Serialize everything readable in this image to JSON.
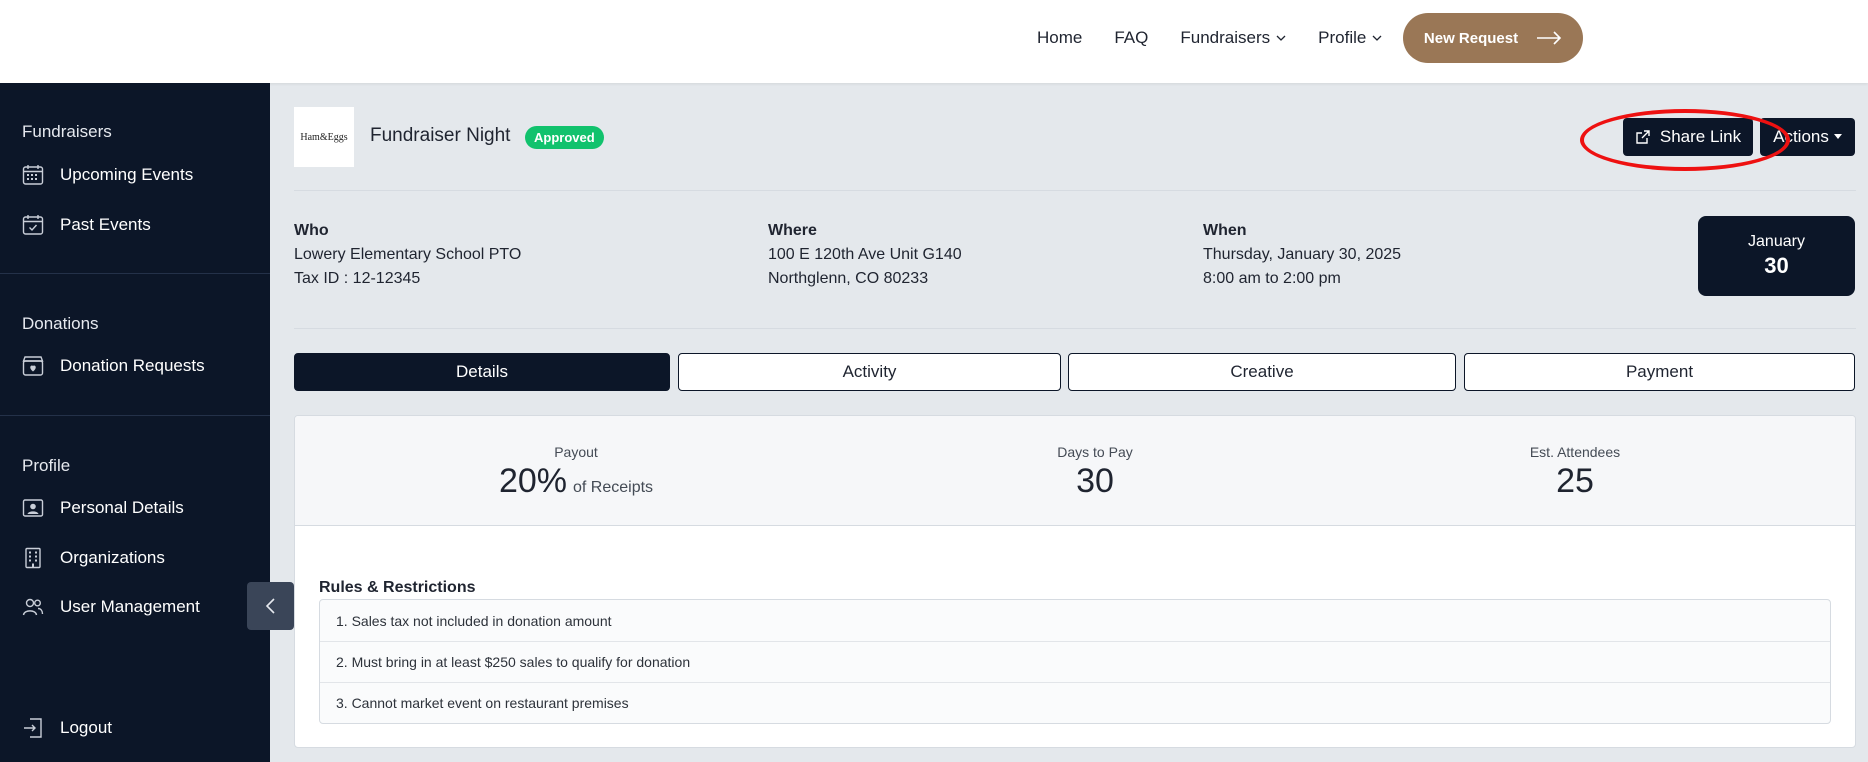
{
  "nav": {
    "home": "Home",
    "faq": "FAQ",
    "fundraisers": "Fundraisers",
    "profile": "Profile",
    "new_request": "New Request"
  },
  "sidebar": {
    "section_fundraisers": "Fundraisers",
    "upcoming_events": "Upcoming Events",
    "past_events": "Past Events",
    "section_donations": "Donations",
    "donation_requests": "Donation Requests",
    "section_profile": "Profile",
    "personal_details": "Personal Details",
    "organizations": "Organizations",
    "user_management": "User Management",
    "logout": "Logout"
  },
  "event": {
    "logo_text": "Ham&Eggs",
    "title": "Fundraiser Night",
    "status": "Approved",
    "share_link": "Share Link",
    "actions": "Actions",
    "who_label": "Who",
    "who_line1": "Lowery Elementary School PTO",
    "who_line2": "Tax ID : 12-12345",
    "where_label": "Where",
    "where_line1": "100 E 120th Ave Unit G140",
    "where_line2": "Northglenn, CO 80233",
    "when_label": "When",
    "when_line1": "Thursday, January 30, 2025",
    "when_line2": "8:00 am to 2:00 pm",
    "date_month": "January",
    "date_day": "30"
  },
  "tabs": [
    "Details",
    "Activity",
    "Creative",
    "Payment"
  ],
  "stats": {
    "payout_label": "Payout",
    "payout_value": "20%",
    "payout_sub": "of Receipts",
    "days_label": "Days to Pay",
    "days_value": "30",
    "attendees_label": "Est. Attendees",
    "attendees_value": "25"
  },
  "rules": {
    "title": "Rules & Restrictions",
    "items": [
      "1. Sales tax not included in donation amount",
      "2. Must bring in at least $250 sales to qualify for donation",
      "3. Cannot market event on restaurant premises"
    ]
  },
  "colors": {
    "sidebar_bg": "#0c1628",
    "accent_brown": "#9a7756",
    "approved_green": "#11c26d",
    "annotation_red": "#e11111"
  }
}
